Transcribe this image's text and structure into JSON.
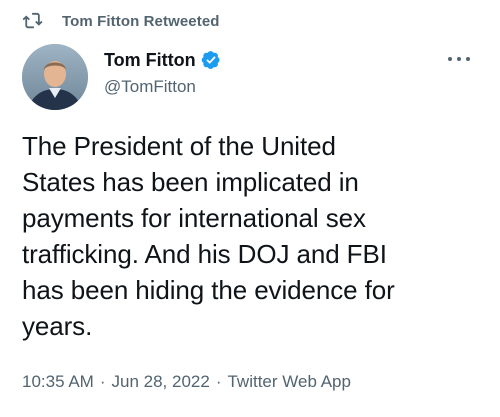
{
  "retweet": {
    "label": "Tom Fitton Retweeted",
    "icon": "retweet-icon"
  },
  "author": {
    "display_name": "Tom Fitton",
    "handle": "@TomFitton",
    "verified": true,
    "verified_color": "#1d9bf0"
  },
  "tweet": {
    "text": "The President of the United\nStates has been implicated in\npayments for international sex\ntrafficking. And his DOJ and FBI\nhas been hiding the evidence for\nyears.",
    "time": "10:35 AM",
    "date": "Jun 28, 2022",
    "source": "Twitter Web App",
    "separator": "·"
  },
  "colors": {
    "text_primary": "#0f1419",
    "text_secondary": "#536471",
    "background": "#ffffff"
  },
  "icons": {
    "more": "more-options-icon",
    "verified": "verified-badge-icon",
    "avatar": "avatar"
  }
}
